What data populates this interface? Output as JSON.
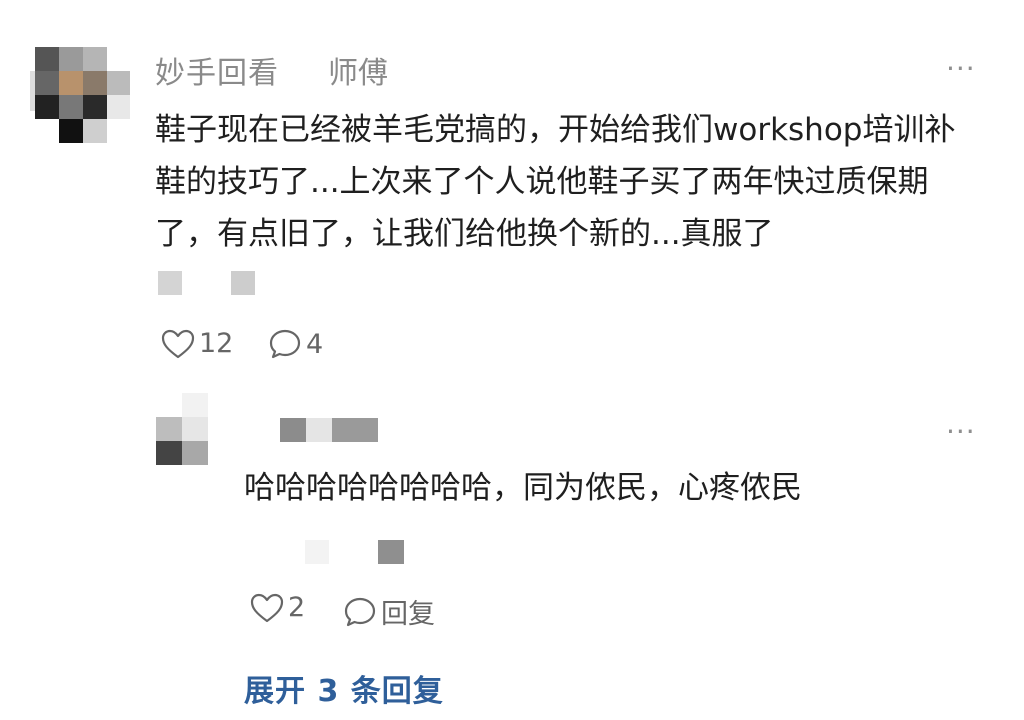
{
  "comment": {
    "author": "妙手回看",
    "author_badge": "师傅",
    "text": "鞋子现在已经被羊毛党搞的，开始给我们workshop培训补鞋的技巧了...上次来了个人说他鞋子买了两年快过质保期了，有点旧了，让我们给他换个新的...真服了",
    "like_count": "12",
    "reply_count": "4"
  },
  "reply": {
    "text": "哈哈哈哈哈哈哈哈，同为侬民，心疼侬民",
    "like_count": "2",
    "reply_label": "回复"
  },
  "expand_label": "展开 3 条回复",
  "more_label": "···",
  "icons": {
    "like": "heart-outline-icon",
    "comment": "speech-bubble-icon",
    "more": "more-dots-icon"
  },
  "colors": {
    "text": "#1f1f1f",
    "meta": "#8a8a8a",
    "link": "#2f5f9a"
  }
}
